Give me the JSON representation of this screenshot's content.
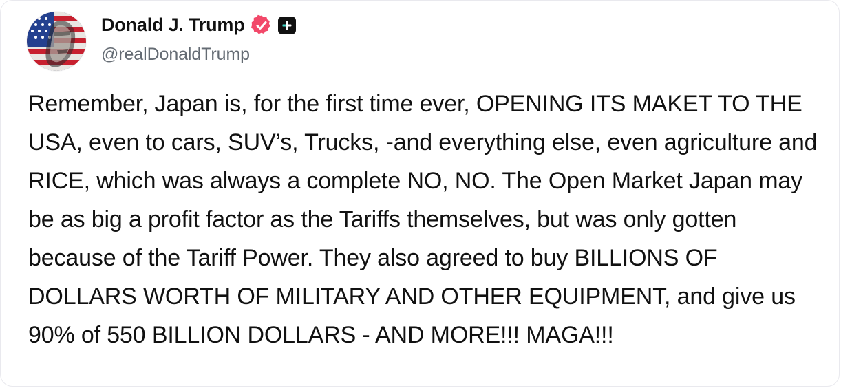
{
  "post": {
    "author": {
      "display_name": "Donald J. Trump",
      "handle": "@realDonaldTrump",
      "verified_icon": "verified-badge-icon",
      "plus_icon": "plus-badge-icon",
      "verified_color": "#f2496a",
      "plus_badge_color": "#111111"
    },
    "text": "Remember, Japan is, for the first time ever, OPENING ITS MAKET TO THE USA, even to cars, SUV’s, Trucks, -and everything else, even agriculture and RICE, which was always a complete NO, NO. The Open Market Japan may be as big a profit factor as the Tariffs themselves, but was only gotten because of the Tariff Power. They also agreed to buy BILLIONS OF DOLLARS WORTH OF MILITARY AND OTHER EQUIPMENT, and give us 90% of 550 BILLION DOLLARS - AND MORE!!! MAGA!!!"
  }
}
